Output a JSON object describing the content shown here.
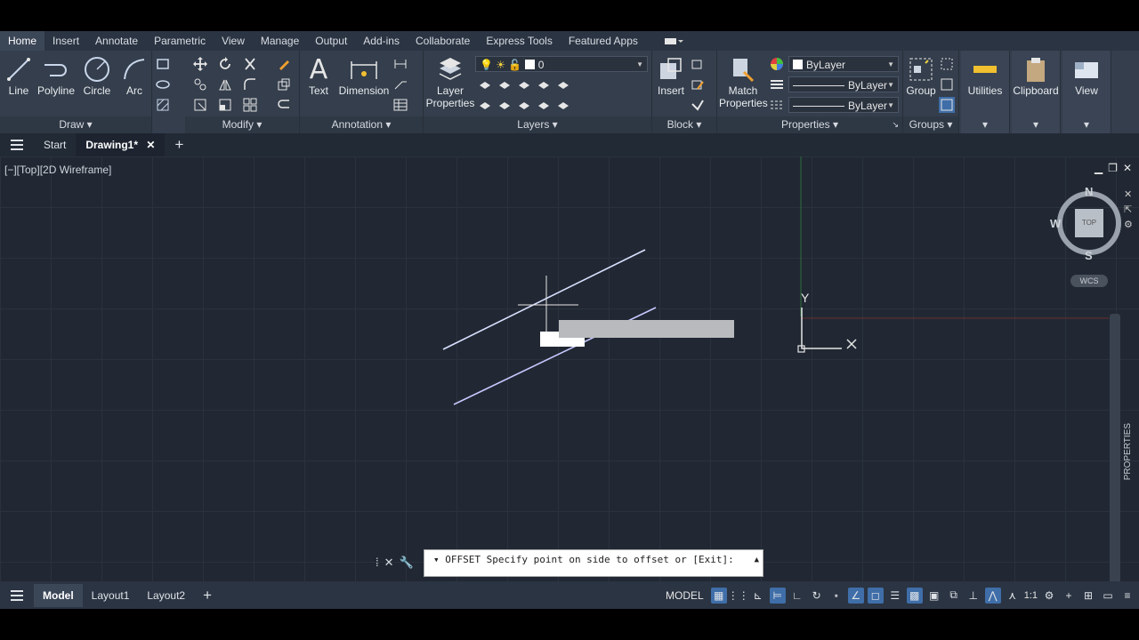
{
  "ribbon_tabs": [
    "Home",
    "Insert",
    "Annotate",
    "Parametric",
    "View",
    "Manage",
    "Output",
    "Add-ins",
    "Collaborate",
    "Express Tools",
    "Featured Apps"
  ],
  "draw": {
    "line": "Line",
    "polyline": "Polyline",
    "circle": "Circle",
    "arc": "Arc",
    "title": "Draw"
  },
  "modify": {
    "title": "Modify"
  },
  "annotation": {
    "text": "Text",
    "dimension": "Dimension",
    "title": "Annotation"
  },
  "layers": {
    "layer_properties": "Layer Properties",
    "current_layer": "0",
    "title": "Layers"
  },
  "block": {
    "insert": "Insert",
    "title": "Block"
  },
  "properties": {
    "match": "Match Properties",
    "color": "ByLayer",
    "linetype": "ByLayer",
    "lineweight": "ByLayer",
    "title": "Properties"
  },
  "groups": {
    "group": "Group",
    "title": "Groups"
  },
  "utilities": {
    "label": "Utilities"
  },
  "clipboard": {
    "label": "Clipboard"
  },
  "view": {
    "label": "View"
  },
  "file_tabs": {
    "start": "Start",
    "drawing": "Drawing1*"
  },
  "viewport": {
    "label": "[−][Top][2D Wireframe]",
    "cube_face": "TOP",
    "north": "N",
    "south": "S",
    "west": "W",
    "wcs": "WCS",
    "ucs_y": "Y",
    "properties_tab": "PROPERTIES"
  },
  "command": {
    "text": "▾ OFFSET Specify point on side to offset or [Exit]:"
  },
  "layout_tabs": {
    "model": "Model",
    "layout1": "Layout1",
    "layout2": "Layout2"
  },
  "status": {
    "model": "MODEL",
    "scale": "1:1"
  },
  "colors": {
    "accent": "#3f6ea8",
    "ribbon": "#343e4c",
    "viewport": "#212833"
  }
}
